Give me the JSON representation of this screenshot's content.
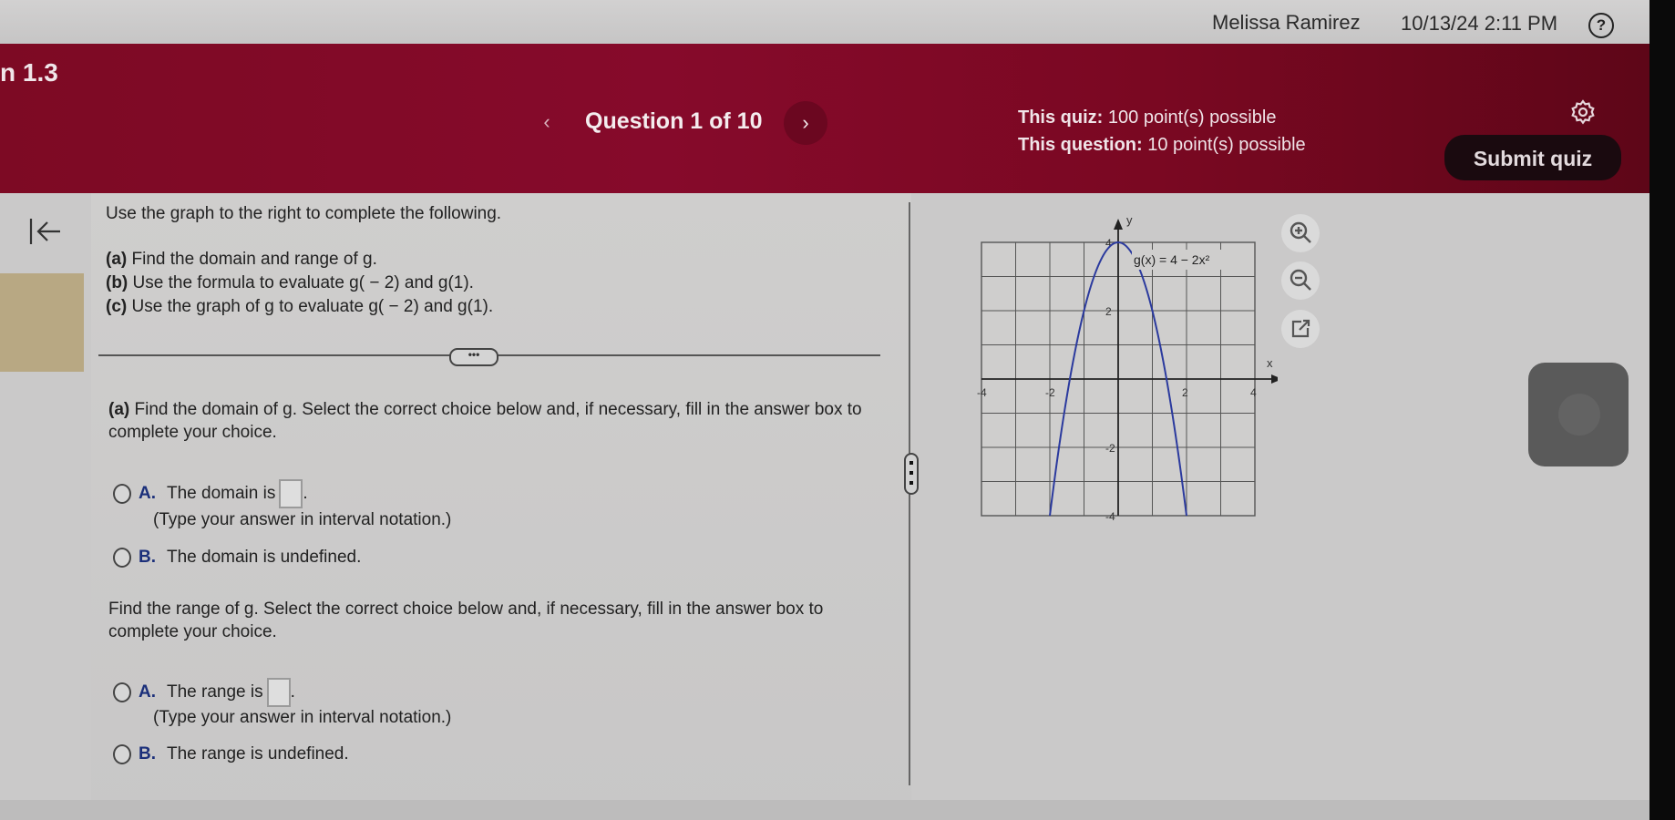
{
  "topbar": {
    "user_name": "Melissa Ramirez",
    "datetime": "10/13/24 2:11 PM",
    "help_icon": "question-circle-icon"
  },
  "header": {
    "section_title": "n 1.3",
    "question_label": "Question 1 of 10",
    "prev_icon": "chevron-left-icon",
    "next_icon": "chevron-right-icon",
    "quiz_points_label": "This quiz:",
    "quiz_points_value": "100 point(s) possible",
    "question_points_label": "This question:",
    "question_points_value": "10 point(s) possible",
    "settings_icon": "gear-icon",
    "submit_label": "Submit quiz",
    "accent_color": "#860a2b"
  },
  "problem": {
    "prompt": "Use the graph to the right to complete the following.",
    "parts": [
      {
        "tag": "(a)",
        "text": " Find the domain and range of g."
      },
      {
        "tag": "(b)",
        "text": " Use the formula to evaluate g( − 2) and g(1)."
      },
      {
        "tag": "(c)",
        "text": " Use the graph of g to evaluate g( − 2) and g(1)."
      }
    ],
    "more_label": "•••"
  },
  "answer": {
    "domain_question_tag": "(a)",
    "domain_question": " Find the domain of g. Select the correct choice below and, if necessary, fill in the answer box to complete your choice.",
    "domain_choices": [
      {
        "letter": "A.",
        "text": "The domain is",
        "suffix": ".",
        "has_box": true
      },
      {
        "letter": "B.",
        "text": "The domain is undefined."
      }
    ],
    "domain_hint": "(Type your answer in interval notation.)",
    "range_question": "Find the range of g. Select the correct choice below and, if necessary, fill in the answer box to complete your choice.",
    "range_choices": [
      {
        "letter": "A.",
        "text": "The range is",
        "suffix": ".",
        "has_box": true
      },
      {
        "letter": "B.",
        "text": "The range is undefined."
      }
    ],
    "range_hint": "(Type your answer in interval notation.)"
  },
  "graph": {
    "function_label": "g(x) = 4 − 2x²",
    "x_axis_label": "x",
    "y_axis_label": "y",
    "x_range": [
      -4,
      4
    ],
    "y_range": [
      -4,
      4
    ],
    "x_ticks": [
      "-4",
      "-2",
      "2",
      "4"
    ],
    "y_ticks": [
      "4",
      "2",
      "-2",
      "-4"
    ],
    "curve_color": "#2b3a9e",
    "tools": [
      "zoom-in-icon",
      "zoom-out-icon",
      "external-link-icon"
    ]
  }
}
